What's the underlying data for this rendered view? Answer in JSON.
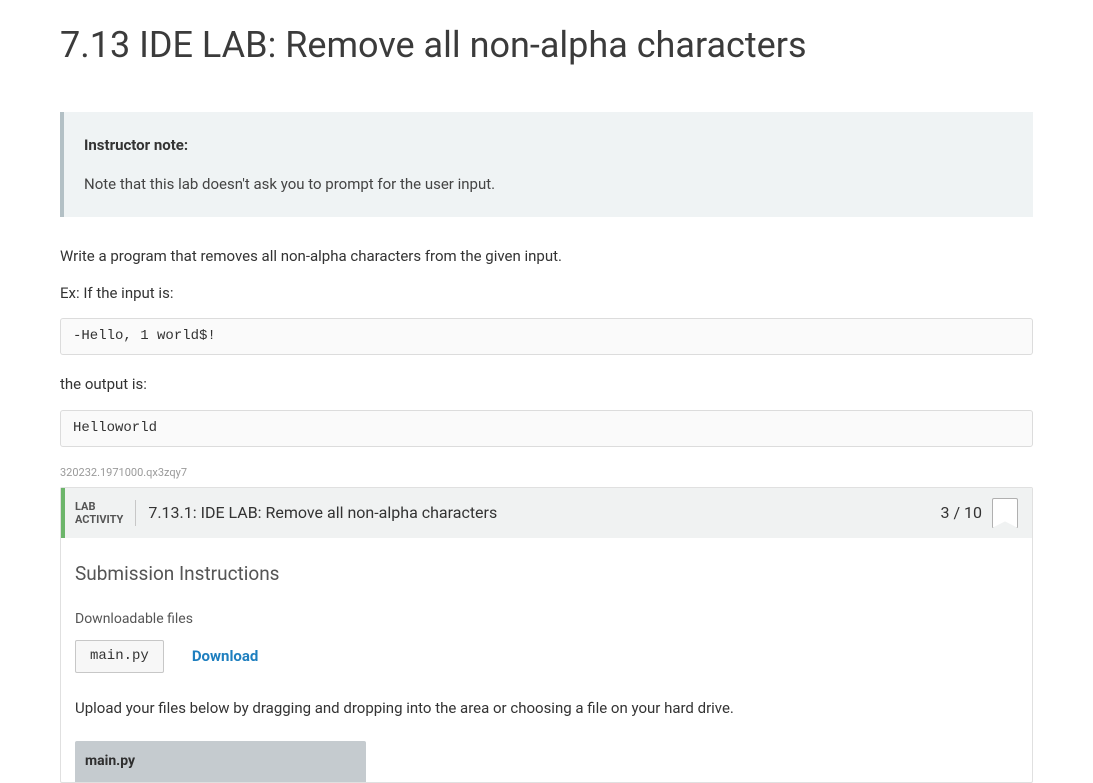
{
  "page": {
    "title": "7.13 IDE LAB: Remove all non-alpha characters"
  },
  "note": {
    "heading": "Instructor note:",
    "body": "Note that this lab doesn't ask you to prompt for the user input."
  },
  "instructions": {
    "line1": "Write a program that removes all non-alpha characters from the given input.",
    "line2": "Ex: If the input is:",
    "example_input": "-Hello, 1 world$!",
    "line3": "the output is:",
    "example_output": "Helloworld"
  },
  "ref_id": "320232.1971000.qx3zqy7",
  "lab": {
    "tag_line1": "LAB",
    "tag_line2": "ACTIVITY",
    "title": "7.13.1: IDE LAB: Remove all non-alpha characters",
    "score": "3 / 10"
  },
  "submission": {
    "heading": "Submission Instructions",
    "downloadable_label": "Downloadable files",
    "file_name": "main.py",
    "download_label": "Download",
    "upload_text": "Upload your files below by dragging and dropping into the area or choosing a file on your hard drive.",
    "upload_tab": "main.py"
  }
}
